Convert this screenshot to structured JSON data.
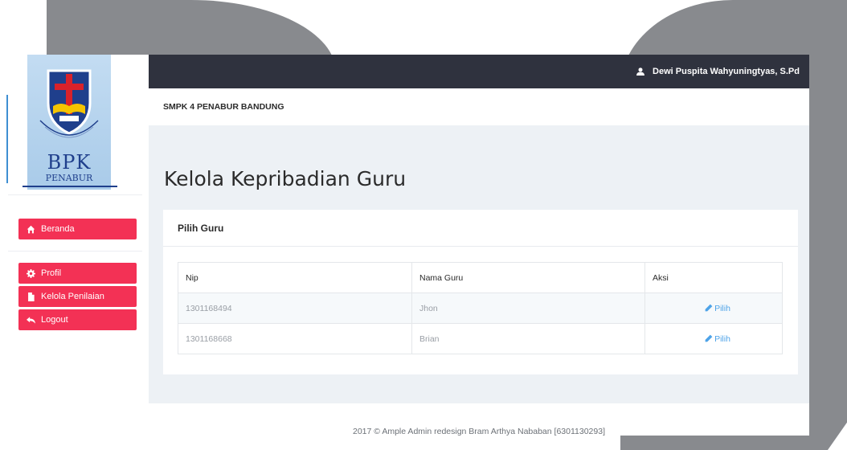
{
  "logo": {
    "text": "BPK",
    "subtitle": "PENABUR"
  },
  "nav": {
    "home": "Beranda",
    "profile": "Profil",
    "grades": "Kelola Penilaian",
    "logout": "Logout"
  },
  "topbar": {
    "user_name": "Dewi Puspita Wahyuningtyas, S.Pd"
  },
  "breadcrumb": "SMPK 4 PENABUR BANDUNG",
  "page_title": "Kelola Kepribadian Guru",
  "panel": {
    "title": "Pilih Guru",
    "columns": [
      "Nip",
      "Nama Guru",
      "Aksi"
    ],
    "rows": [
      {
        "nip": "1301168494",
        "nama": "Jhon",
        "aksi": "Pilih"
      },
      {
        "nip": "1301168668",
        "nama": "Brian",
        "aksi": "Pilih"
      }
    ]
  },
  "footer": "2017 © Ample Admin redesign Bram Arthya Nababan [6301130293]",
  "colors": {
    "accent": "#f33155",
    "topbar": "#2f323e",
    "link": "#4ea3e8",
    "content_bg": "#edf1f5"
  }
}
